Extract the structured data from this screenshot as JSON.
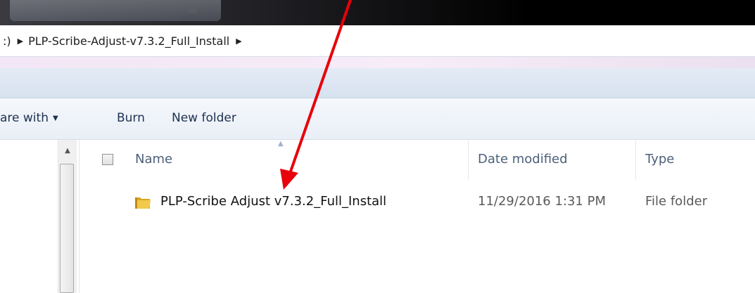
{
  "address": {
    "drive_fragment": ":)",
    "folder": "PLP-Scribe-Adjust-v7.3.2_Full_Install"
  },
  "toolbar": {
    "share_label": "are with",
    "burn_label": "Burn",
    "new_folder_label": "New folder"
  },
  "columns": {
    "name": "Name",
    "date": "Date modified",
    "type": "Type"
  },
  "rows": [
    {
      "name": "PLP-Scribe Adjust v7.3.2_Full_Install",
      "date": "11/29/2016 1:31 PM",
      "type": "File folder"
    }
  ],
  "colors": {
    "annotation_arrow": "#e8000b",
    "folder": "#e8b830",
    "column_header_text": "#4c607a"
  },
  "icons": {
    "folder": "folder-icon",
    "breadcrumb_separator": "breadcrumb-chevron-icon",
    "annotation": "red-arrow-annotation"
  }
}
